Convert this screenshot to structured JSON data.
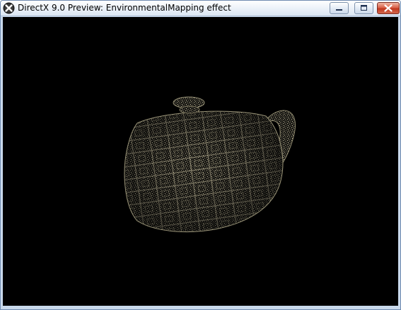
{
  "window": {
    "title": "DirectX 9.0 Preview: EnvironmentalMapping effect",
    "app_icon": "directx-icon",
    "controls": {
      "minimize_icon": "minimize-icon",
      "maximize_icon": "maximize-icon",
      "close_icon": "close-icon"
    }
  },
  "viewport": {
    "background_color": "#000000",
    "subject": "teapot",
    "texture_color": "#c8c0a0"
  },
  "theme": {
    "titlebar_color": "#e6eef8",
    "frame_color": "#c9d9ec",
    "close_button_color": "#c8462c"
  }
}
